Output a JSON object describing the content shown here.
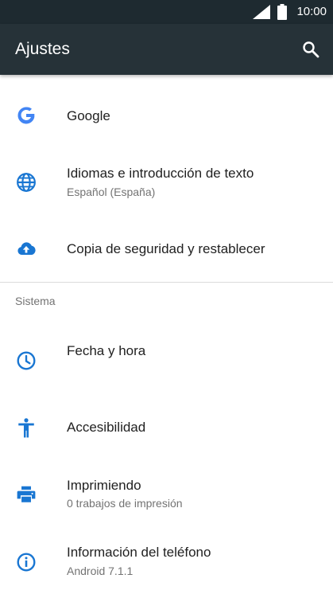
{
  "status_bar": {
    "time": "10:00",
    "icons": [
      "signal-icon",
      "battery-icon"
    ]
  },
  "app_bar": {
    "title": "Ajustes",
    "search_icon": "search-icon"
  },
  "colors": {
    "accent": "#1976d2",
    "app_bar": "#263238",
    "status_bar": "#1e2a30"
  },
  "items_top": [
    {
      "icon": "google-icon",
      "label": "Google",
      "subtitle": ""
    },
    {
      "icon": "globe-icon",
      "label": "Idiomas e introducción de texto",
      "subtitle": "Español (España)"
    },
    {
      "icon": "cloud-upload-icon",
      "label": "Copia de seguridad y restablecer",
      "subtitle": ""
    }
  ],
  "section_header": "Sistema",
  "items_system": [
    {
      "icon": "clock-icon",
      "label": "Fecha y hora",
      "subtitle": ""
    },
    {
      "icon": "accessibility-icon",
      "label": "Accesibilidad",
      "subtitle": ""
    },
    {
      "icon": "printer-icon",
      "label": "Imprimiendo",
      "subtitle": "0 trabajos de impresión"
    },
    {
      "icon": "info-icon",
      "label": "Información del teléfono",
      "subtitle": "Android 7.1.1"
    }
  ]
}
